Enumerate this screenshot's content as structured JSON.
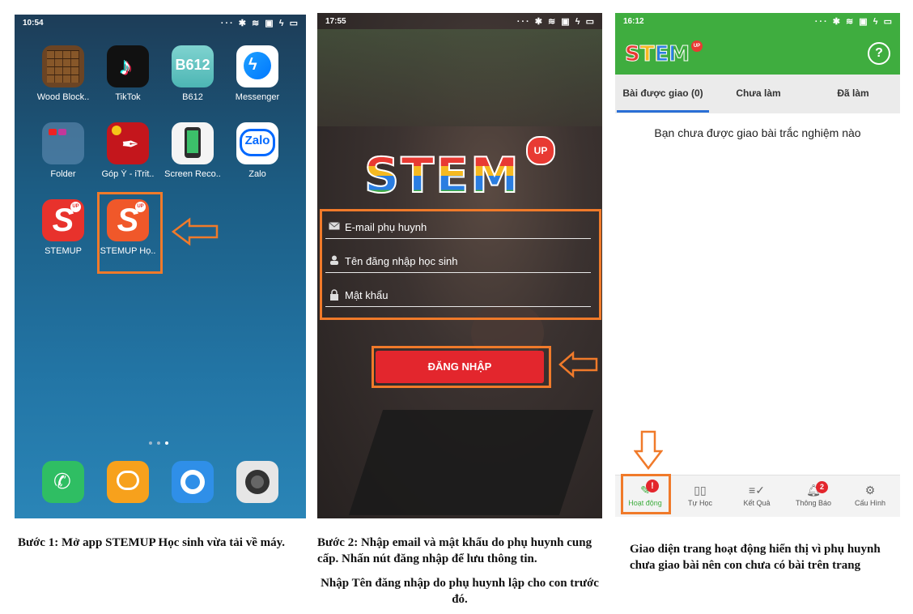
{
  "phone1": {
    "time": "10:54",
    "apps": [
      {
        "label": "Wood Block..",
        "icon": "wood-block-app-icon"
      },
      {
        "label": "TikTok",
        "icon": "tiktok-app-icon"
      },
      {
        "label": "B612",
        "icon": "b612-app-icon"
      },
      {
        "label": "Messenger",
        "icon": "messenger-app-icon"
      },
      {
        "label": "Folder",
        "icon": "folder-icon"
      },
      {
        "label": "Góp Ý - iTrit..",
        "icon": "gop-y-app-icon"
      },
      {
        "label": "Screen Reco..",
        "icon": "screen-recorder-icon"
      },
      {
        "label": "Zalo",
        "icon": "zalo-app-icon"
      },
      {
        "label": "STEMUP",
        "icon": "stemup-app-icon"
      },
      {
        "label": "STEMUP Họ..",
        "icon": "stemup-hoc-sinh-app-icon"
      }
    ],
    "icon_texts": {
      "b612": "B612",
      "zalo": "Zalo",
      "stem_letter": "S",
      "up_badge": "UP"
    },
    "dock": [
      "phone-icon",
      "message-icon",
      "browser-icon",
      "camera-icon"
    ],
    "caption": "Bước 1: Mở app STEMUP Học sinh vừa tải về máy."
  },
  "phone2": {
    "time": "17:55",
    "logo_text": "STEM",
    "logo_badge": "UP",
    "email_placeholder": "E-mail phụ huynh",
    "username_placeholder": "Tên đăng nhập học sinh",
    "password_placeholder": "Mật khẩu",
    "login_button": "ĐĂNG NHẬP",
    "caption_1": "Bước 2: Nhập email và mật khẩu do phụ huynh cung cấp. Nhấn nút đăng nhập để lưu thông tin.",
    "caption_2": "Nhập Tên đăng nhập do phụ huynh lập cho con trước đó."
  },
  "phone3": {
    "time": "16:12",
    "logo_text": "STEM",
    "logo_badge": "UP",
    "help_icon": "?",
    "tabs": [
      "Bài được giao (0)",
      "Chưa làm",
      "Đã làm"
    ],
    "empty_message": "Bạn chưa được giao bài trắc nghiệm nào",
    "nav": [
      {
        "label": "Hoạt động",
        "icon": "activity-icon",
        "badge": "!"
      },
      {
        "label": "Tự Học",
        "icon": "book-icon",
        "badge": ""
      },
      {
        "label": "Kết Quả",
        "icon": "result-icon",
        "badge": ""
      },
      {
        "label": "Thông Báo",
        "icon": "bell-icon",
        "badge": "2"
      },
      {
        "label": "Cấu Hình",
        "icon": "gear-icon",
        "badge": ""
      }
    ],
    "caption": "Giao diện trang hoạt động hiển thị vì phụ huynh chưa giao bài nên con chưa có bài trên trang"
  },
  "colors": {
    "accent_orange": "#f07a2a",
    "header_green": "#3fad3f",
    "login_red": "#e3262d",
    "tab_underline": "#2b6fd6"
  }
}
